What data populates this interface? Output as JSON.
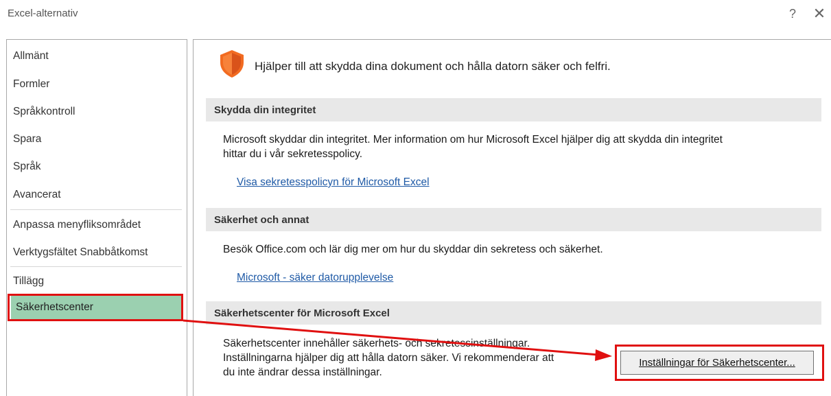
{
  "window": {
    "title": "Excel-alternativ",
    "help_glyph": "?",
    "close_glyph": "✕"
  },
  "sidebar": {
    "items": [
      {
        "label": "Allmänt"
      },
      {
        "label": "Formler"
      },
      {
        "label": "Språkkontroll"
      },
      {
        "label": "Spara"
      },
      {
        "label": "Språk"
      },
      {
        "label": "Avancerat"
      },
      {
        "label": "Anpassa menyfliksområdet"
      },
      {
        "label": "Verktygsfältet Snabbåtkomst"
      },
      {
        "label": "Tillägg"
      },
      {
        "label": "Säkerhetscenter",
        "selected": true
      }
    ]
  },
  "main": {
    "intro": "Hjälper till att skydda dina dokument och hålla datorn säker och felfri.",
    "sections": [
      {
        "header": "Skydda din integritet",
        "text_line1": "Microsoft skyddar din integritet. Mer information om hur Microsoft Excel hjälper dig att skydda din integritet",
        "text_line2": "hittar du i vår sekretesspolicy.",
        "link": "Visa sekretesspolicyn för Microsoft Excel"
      },
      {
        "header": "Säkerhet och annat",
        "text_line1": "Besök Office.com och lär dig mer om hur du skyddar din sekretess och säkerhet.",
        "link": "Microsoft - säker datorupplevelse"
      },
      {
        "header": "Säkerhetscenter för Microsoft Excel",
        "text_line1": "Säkerhetscenter innehåller säkerhets- och sekretessinställningar.",
        "text_line2": "Inställningarna hjälper dig att hålla datorn säker. Vi rekommenderar att",
        "text_line3": "du inte ändrar dessa inställningar.",
        "button": "Inställningar för Säkerhetscenter..."
      }
    ]
  },
  "colors": {
    "selected_bg": "#9bd0b0",
    "section_header_bg": "#e8e8e8",
    "link": "#1f5aa6",
    "annotation_red": "#e01010",
    "shield_orange": "#f26b21"
  },
  "icons": {
    "shield": "shield-icon",
    "help": "help-icon",
    "close": "close-icon"
  }
}
